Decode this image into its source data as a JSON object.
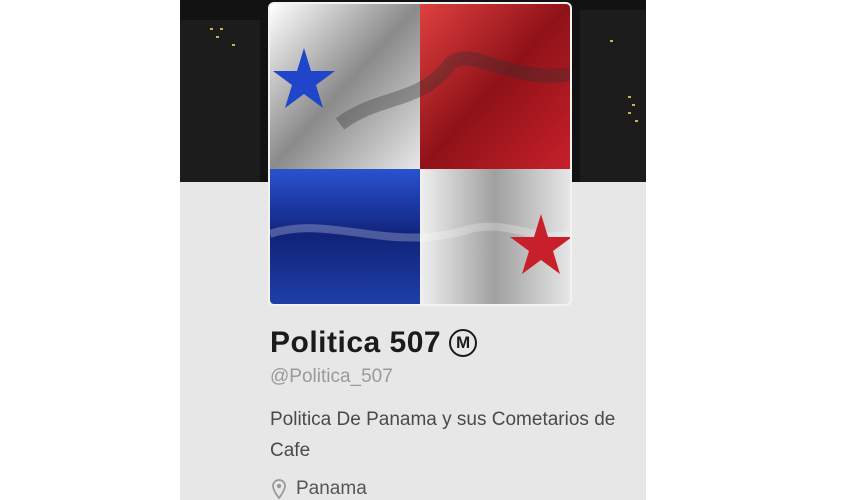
{
  "profile": {
    "name": "Politica 507",
    "badge_letter": "M",
    "handle": "@Politica_507",
    "bio_line1": "Politica De Panama y sus Cometarios de",
    "bio_line2": "Cafe",
    "location": "Panama"
  },
  "icons": {
    "avatar": "panama-flag-avatar",
    "location": "location-pin-icon",
    "badge": "circled-m-badge"
  },
  "colors": {
    "flag_blue": "#1f3fa8",
    "flag_red": "#c8202a",
    "banner_bg": "#121212",
    "text_dark": "#1b1b1b",
    "handle_gray": "#9a9a9a"
  }
}
